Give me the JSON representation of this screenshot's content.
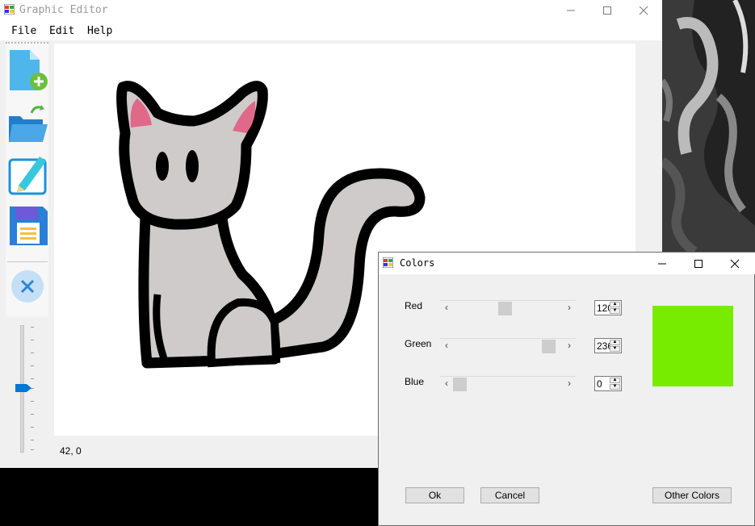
{
  "main_window": {
    "title": "Graphic Editor",
    "menu": [
      "File",
      "Edit",
      "Help"
    ],
    "tools": [
      "new-file-icon",
      "open-folder-icon",
      "edit-pencil-icon",
      "save-icon",
      "close-cancel-icon"
    ],
    "status_coords": "42, 0",
    "brush_size_level": 0.5
  },
  "colors_dialog": {
    "title": "Colors",
    "labels": {
      "red": "Red",
      "green": "Green",
      "blue": "Blue"
    },
    "values": {
      "red": "120",
      "green": "236",
      "blue": "0"
    },
    "preview_color": "#78ec00",
    "buttons": {
      "ok": "Ok",
      "cancel": "Cancel",
      "other": "Other Colors"
    }
  },
  "drawing": {
    "subject": "cat",
    "fill_color": "#cfcbca",
    "outline_color": "#000000",
    "ear_color": "#e0698a"
  }
}
